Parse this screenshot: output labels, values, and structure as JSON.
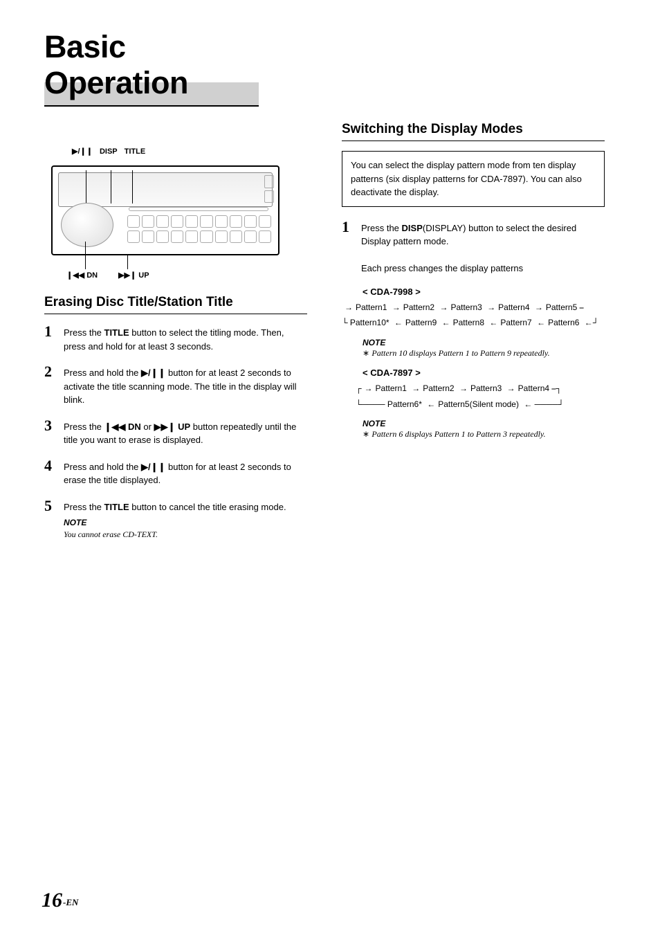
{
  "page_title": "Basic Operation",
  "diagram": {
    "top_labels": {
      "play": "▶/❙❙",
      "disp": "DISP",
      "title": "TITLE"
    },
    "bottom_labels": {
      "dn_sym": "❙◀◀",
      "dn": "DN",
      "up_sym": "▶▶❙",
      "up": "UP"
    }
  },
  "left": {
    "heading": "Erasing Disc Title/Station Title",
    "steps": [
      {
        "n": "1",
        "pre": "Press the ",
        "bold": "TITLE",
        "post": " button to select the titling mode. Then, press and hold for at least 3 seconds."
      },
      {
        "n": "2",
        "pre": "Press and hold the ",
        "bold": "▶/❙❙",
        "post": " button for at least 2 seconds to activate the title scanning mode. The title in the display will blink."
      },
      {
        "n": "3",
        "pre": "Press the ",
        "bold": "❙◀◀ DN",
        "mid": " or ",
        "bold2": "▶▶❙ UP",
        "post": " button repeatedly until the title you want to erase is displayed."
      },
      {
        "n": "4",
        "pre": "Press and hold the ",
        "bold": "▶/❙❙",
        "post": " button for at least 2 seconds to erase the title displayed."
      },
      {
        "n": "5",
        "pre": "Press the ",
        "bold": "TITLE",
        "post": " button to cancel the title erasing mode."
      }
    ],
    "note_label": "NOTE",
    "note_text": "You cannot erase CD-TEXT."
  },
  "right": {
    "heading": "Switching the Display Modes",
    "intro": "You can select the display pattern mode from ten display patterns (six display patterns for CDA-7897). You can also deactivate the display.",
    "step1_pre": "Press the ",
    "step1_bold": "DISP",
    "step1_paren": "(DISPLAY)",
    "step1_post": " button to select the desired Display pattern mode.",
    "each_press": "Each press changes the display patterns",
    "model1": "< CDA-7998 >",
    "flow1a": [
      "Pattern1",
      "Pattern2",
      "Pattern3",
      "Pattern4",
      "Pattern5"
    ],
    "flow1b": [
      "Pattern10*",
      "Pattern9",
      "Pattern8",
      "Pattern7",
      "Pattern6"
    ],
    "note1_label": "NOTE",
    "note1_text": "Pattern 10 displays Pattern 1 to Pattern 9 repeatedly.",
    "model2": "< CDA-7897 >",
    "flow2a": [
      "Pattern1",
      "Pattern2",
      "Pattern3",
      "Pattern4"
    ],
    "flow2b": [
      "Pattern6*",
      "Pattern5(Silent mode)"
    ],
    "note2_label": "NOTE",
    "note2_text": "Pattern 6 displays Pattern 1 to Pattern 3 repeatedly."
  },
  "footer": {
    "page": "16",
    "suffix": "-EN"
  }
}
